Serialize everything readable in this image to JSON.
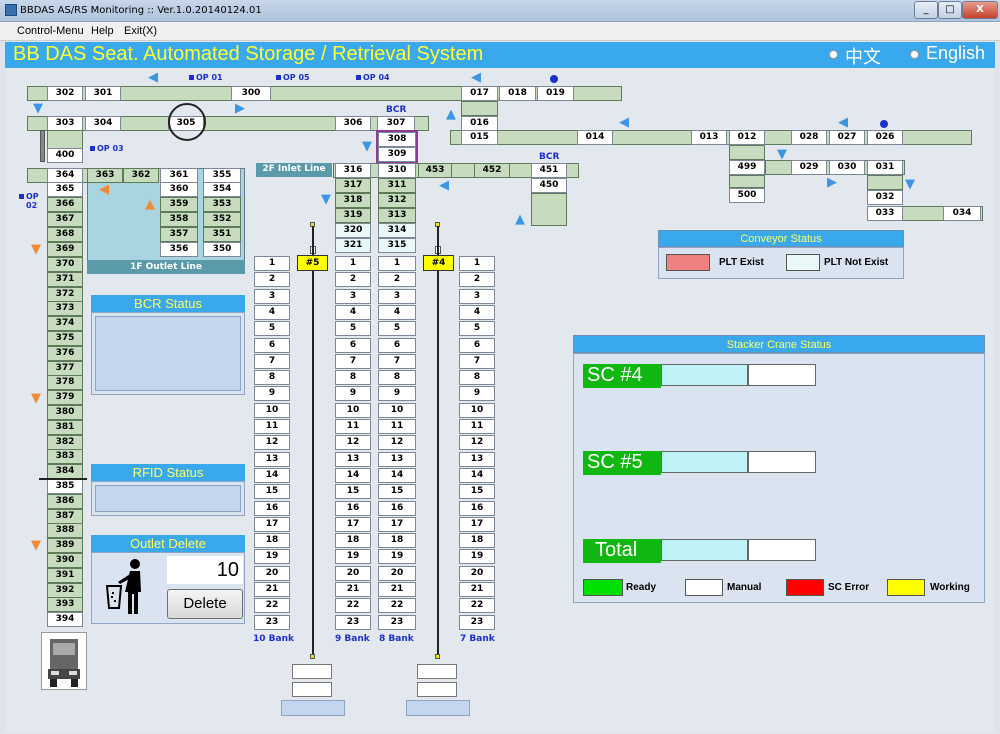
{
  "window": {
    "title": "BBDAS AS/RS Monitoring :: Ver.1.0.20140124.01",
    "min": "_",
    "max": "□",
    "close": "X"
  },
  "menu": [
    "Control-Menu",
    "Help",
    "Exit(X)"
  ],
  "header": {
    "title": "BB DAS Seat. Automated Storage / Retrieval System",
    "lang_cn": "中文",
    "lang_en": "English"
  },
  "op_labels": [
    "OP 01",
    "OP 05",
    "OP 04",
    "OP 03",
    "OP",
    "02"
  ],
  "bcr_labels": [
    "BCR",
    "BCR"
  ],
  "top_cells": [
    "302",
    "301",
    "300",
    "017",
    "018",
    "019",
    "303",
    "304",
    "305",
    "306",
    "307",
    "016",
    "308",
    "309",
    "015",
    "014",
    "013",
    "012",
    "028",
    "027",
    "026",
    "400",
    "499",
    "029",
    "030",
    "031",
    "500",
    "032",
    "033",
    "034",
    "453",
    "452",
    "451",
    "450"
  ],
  "inlet": {
    "label": "2F Inlet Line",
    "cells": [
      "316",
      "310",
      "317",
      "311",
      "318",
      "312",
      "319",
      "313",
      "320",
      "314",
      "321",
      "315"
    ]
  },
  "outlet": {
    "label": "1F Outlet Line",
    "cells": [
      "364",
      "363",
      "362",
      "361",
      "355",
      "365",
      "360",
      "354",
      "366",
      "359",
      "353",
      "367",
      "358",
      "352",
      "368",
      "357",
      "351",
      "369",
      "356",
      "350"
    ]
  },
  "column_cells": [
    "370",
    "371",
    "372",
    "373",
    "374",
    "375",
    "376",
    "377",
    "378",
    "379",
    "380",
    "381",
    "382",
    "383",
    "384",
    "385",
    "386",
    "387",
    "388",
    "389",
    "390",
    "391",
    "392",
    "393",
    "394"
  ],
  "racks": [
    "1",
    "2",
    "3",
    "4",
    "5",
    "6",
    "7",
    "8",
    "9",
    "10",
    "11",
    "12",
    "13",
    "14",
    "15",
    "16",
    "17",
    "18",
    "19",
    "20",
    "21",
    "22",
    "23"
  ],
  "cranes": [
    "#5",
    "#4"
  ],
  "banks": [
    "10 Bank",
    "9 Bank",
    "8 Bank",
    "7 Bank"
  ],
  "bcr_status": {
    "title": "BCR Status"
  },
  "rfid_status": {
    "title": "RFID Status"
  },
  "outlet_delete": {
    "title": "Outlet Delete",
    "count": "10",
    "button": "Delete"
  },
  "conveyor_status": {
    "title": "Conveyor Status",
    "legend": [
      "PLT Exist",
      "PLT Not Exist"
    ],
    "colors": {
      "exist": "#f08080",
      "not_exist": "#eaf7f7"
    }
  },
  "stacker_status": {
    "title": "Stacker Crane Status",
    "rows": [
      "SC #4",
      "SC #5",
      "Total"
    ],
    "legend": [
      "Ready",
      "Manual",
      "SC Error",
      "Working"
    ],
    "colors": {
      "ready": "#00e000",
      "manual": "#ffffff",
      "error": "#ff0000",
      "working": "#ffff00"
    }
  }
}
